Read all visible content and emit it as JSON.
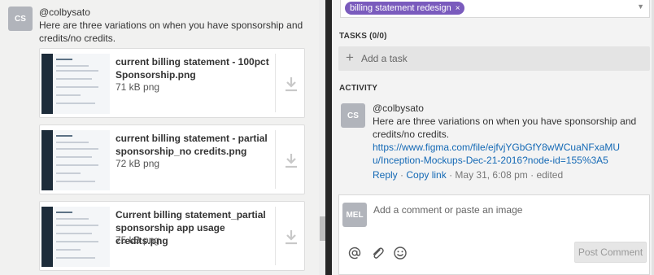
{
  "left_comment": {
    "avatar": "CS",
    "author": "@colbysato",
    "text": "Here are three variations on when you have sponsorship and credits/no credits.",
    "attachments": [
      {
        "name": "current billing statement - 100pct Sponsorship.png",
        "meta": "71 kB png",
        "icon": "download-icon"
      },
      {
        "name": "current billing statement - partial sponsorship_no credits.png",
        "meta": "72 kB png",
        "icon": "download-icon"
      },
      {
        "name": "Current billing statement_partial sponsorship app usage credits.png",
        "meta": "75 kB png",
        "icon": "download-icon"
      }
    ]
  },
  "right": {
    "tag": {
      "label": "billing statement redesign",
      "remove": "×",
      "color": "#7a5bbd"
    },
    "tasks": {
      "label": "TASKS (0/0)",
      "add_label": "Add a task",
      "add_icon": "+"
    },
    "activity": {
      "label": "ACTIVITY",
      "avatar": "CS",
      "author": "@colbysato",
      "text": "Here are three variations on when you have sponsorship and credits/no credits.",
      "link": "https://www.figma.com/file/ejfvjYGbGfY8wWCuaNFxaMUu/Inception-Mockups-Dec-21-2016?node-id=155%3A5",
      "reply": "Reply",
      "dot": "·",
      "copy_link": "Copy link",
      "meta": "· May 31, 6:08 pm · edited"
    },
    "composer": {
      "avatar": "MEL",
      "placeholder": "Add a comment or paste an image",
      "tools": [
        "at-icon",
        "paperclip-icon",
        "smiley-icon"
      ],
      "post_label": "Post Comment"
    }
  },
  "colors": {
    "link": "#1469b5",
    "tag": "#7a5bbd",
    "avatar": "#b1b4bb"
  }
}
